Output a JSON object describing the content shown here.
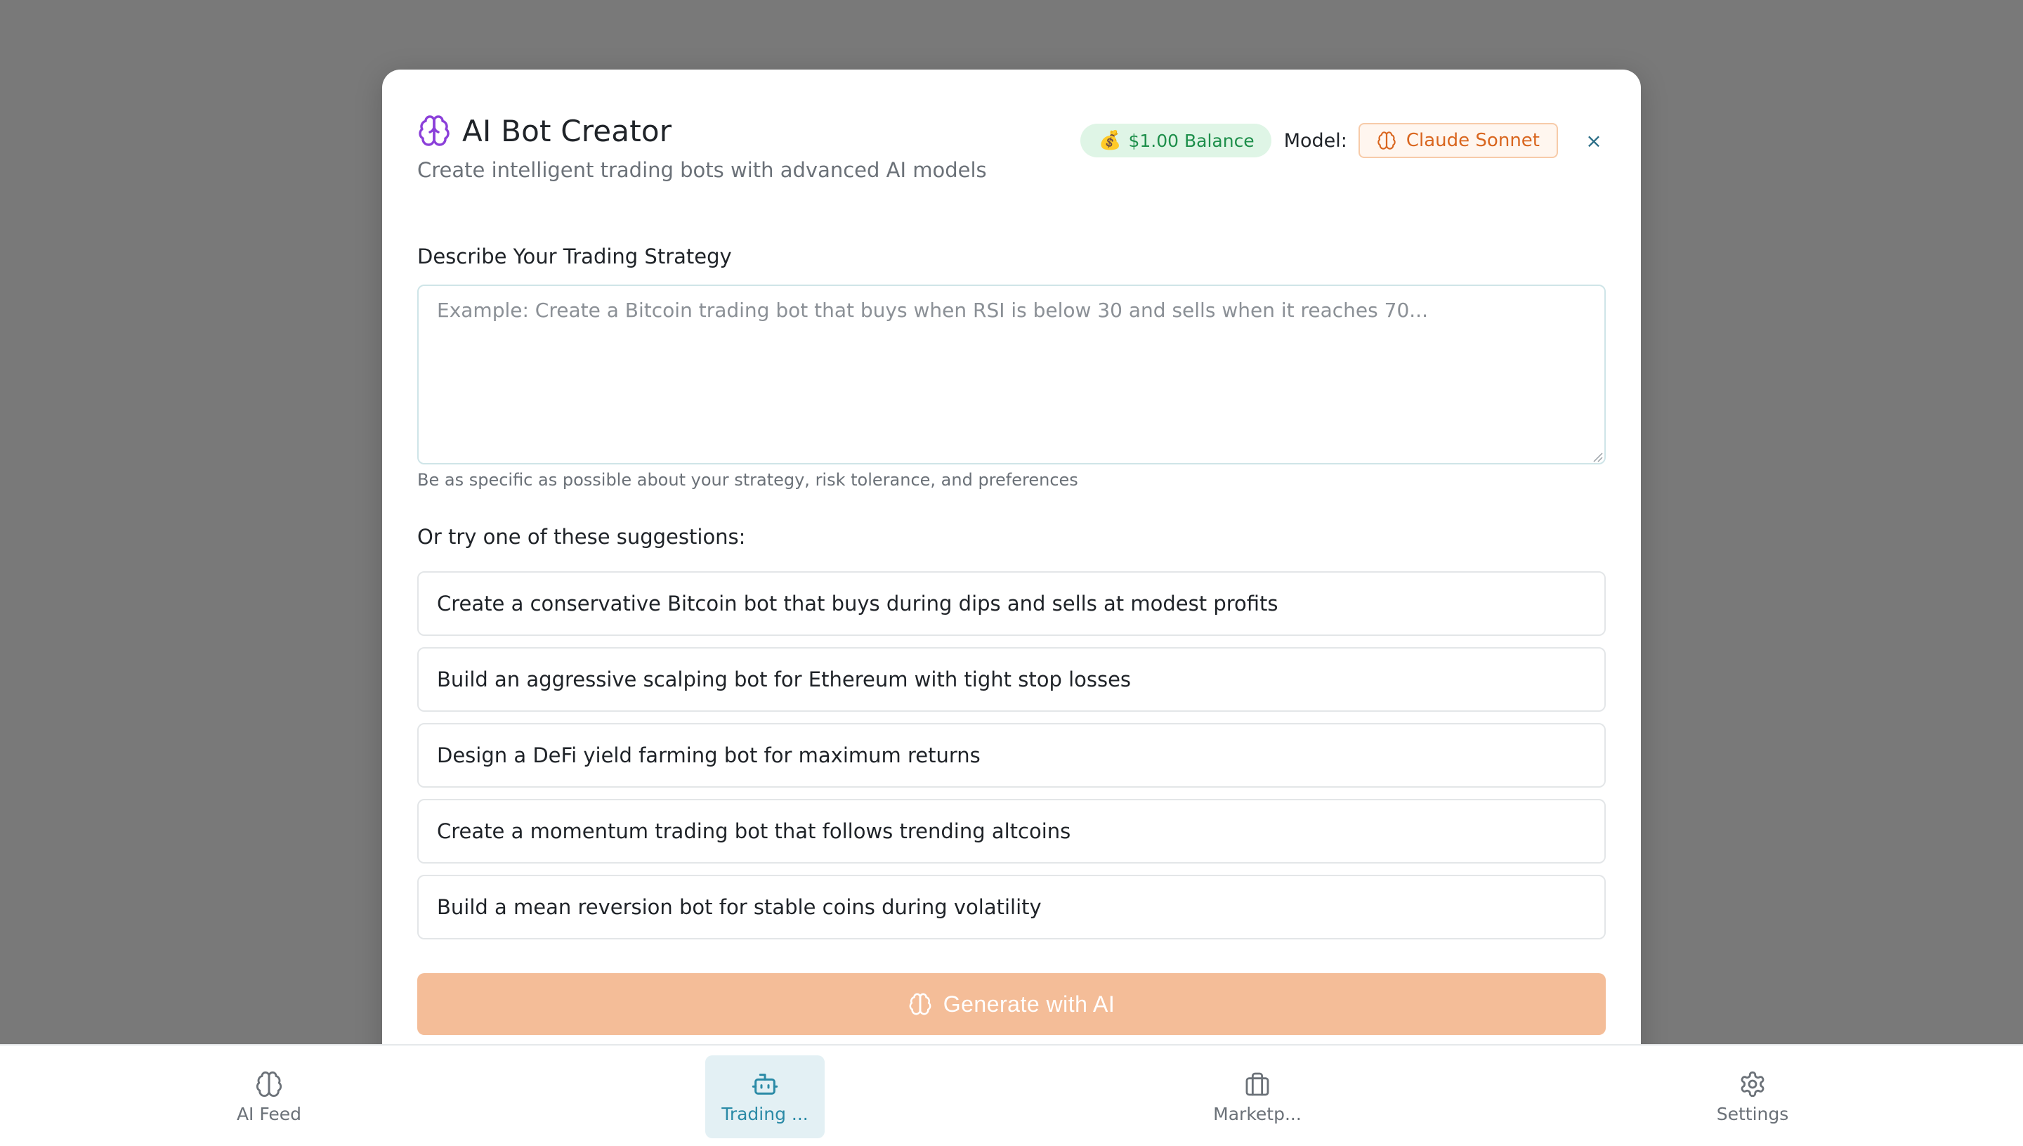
{
  "modal": {
    "title": "AI Bot Creator",
    "subtitle": "Create intelligent trading bots with advanced AI models",
    "balance": "$1.00 Balance",
    "balance_icon": "money-bag-icon",
    "model_label": "Model:",
    "model_name": "Claude Sonnet",
    "close_label": "×"
  },
  "strategy": {
    "label": "Describe Your Trading Strategy",
    "value": "",
    "placeholder": "Example: Create a Bitcoin trading bot that buys when RSI is below 30 and sells when it reaches 70...",
    "helper": "Be as specific as possible about your strategy, risk tolerance, and preferences"
  },
  "suggestions": {
    "label": "Or try one of these suggestions:",
    "items": [
      "Create a conservative Bitcoin bot that buys during dips and sells at modest profits",
      "Build an aggressive scalping bot for Ethereum with tight stop losses",
      "Design a DeFi yield farming bot for maximum returns",
      "Create a momentum trading bot that follows trending altcoins",
      "Build a mean reversion bot for stable coins during volatility"
    ]
  },
  "generate_label": "Generate with AI",
  "nav": {
    "items": [
      {
        "label": "AI Feed",
        "icon": "brain-icon"
      },
      {
        "label": "Trading ...",
        "icon": "robot-icon"
      },
      {
        "label": "Marketp...",
        "icon": "briefcase-icon"
      },
      {
        "label": "Settings",
        "icon": "gear-icon"
      }
    ],
    "active_index": 1
  },
  "colors": {
    "accent_purple": "#8b3fd9",
    "accent_orange": "#d9661f",
    "balance_green": "#1e8f4b",
    "nav_active": "#2a8aa6",
    "generate_bg": "#f4bd98"
  }
}
